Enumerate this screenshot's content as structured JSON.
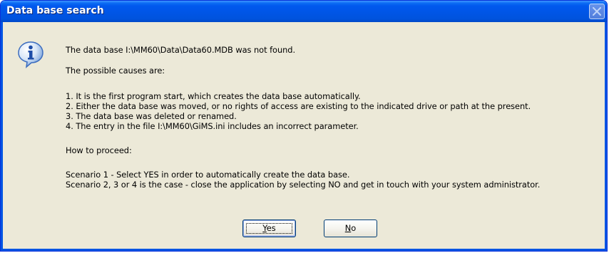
{
  "dialog": {
    "title": "Data base search",
    "icon": "info-icon",
    "accent_color": "#0054e3",
    "message_lines": [
      "The data base  I:\\MM60\\Data\\Data60.MDB was not found.",
      "The possible causes are:",
      "1. It is the first program start, which creates the data base automatically.",
      "2. Either the data base was moved, or no rights of access are existing to the indicated drive or path at the present.",
      "3. The data base was deleted or renamed.",
      "4. The entry in the file I:\\MM60\\GiMS.ini includes an incorrect parameter.",
      "How to proceed:",
      "Scenario 1 - Select YES in order to automatically create the data base.",
      "Scenario 2, 3 or 4 is the case - close the application by selecting NO and get in touch with your system administrator."
    ],
    "buttons": {
      "yes_accel": "Y",
      "yes_rest": "es",
      "no_accel": "N",
      "no_rest": "o"
    }
  }
}
